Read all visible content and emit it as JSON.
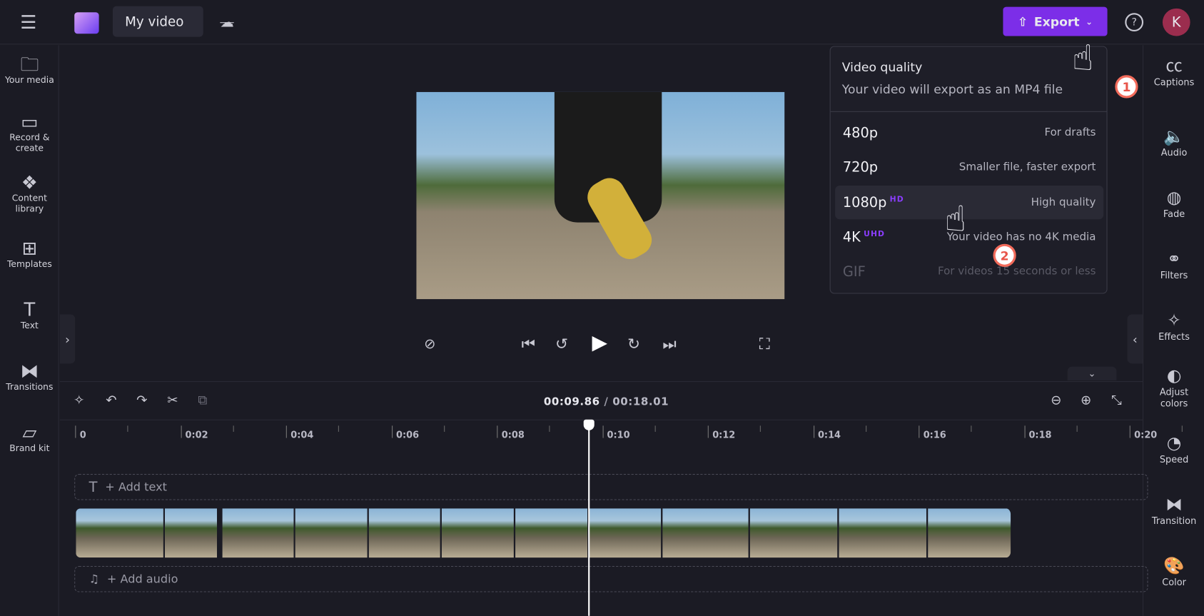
{
  "header": {
    "project_title": "My video",
    "export_label": "Export",
    "avatar_initial": "K"
  },
  "left_nav": [
    {
      "label": "Your media",
      "icon": "folder-icon"
    },
    {
      "label": "Record & create",
      "icon": "camera-icon"
    },
    {
      "label": "Content library",
      "icon": "library-icon"
    },
    {
      "label": "Templates",
      "icon": "templates-icon"
    },
    {
      "label": "Text",
      "icon": "text-icon"
    },
    {
      "label": "Transitions",
      "icon": "transitions-icon"
    },
    {
      "label": "Brand kit",
      "icon": "brand-kit-icon"
    }
  ],
  "right_nav": [
    {
      "label": "Captions"
    },
    {
      "label": "Audio"
    },
    {
      "label": "Fade"
    },
    {
      "label": "Filters"
    },
    {
      "label": "Effects"
    },
    {
      "label": "Adjust colors"
    },
    {
      "label": "Speed"
    },
    {
      "label": "Transition"
    },
    {
      "label": "Color"
    }
  ],
  "export_menu": {
    "title": "Video quality",
    "subtitle": "Your video will export as an MP4 file",
    "options": [
      {
        "label": "480p",
        "badge": "",
        "desc": "For drafts"
      },
      {
        "label": "720p",
        "badge": "",
        "desc": "Smaller file, faster export"
      },
      {
        "label": "1080p",
        "badge": "HD",
        "desc": "High quality"
      },
      {
        "label": "4K",
        "badge": "UHD",
        "desc": "Your video has no 4K media"
      },
      {
        "label": "GIF",
        "badge": "",
        "desc": "For videos 15 seconds or less"
      }
    ]
  },
  "callouts": [
    "1",
    "2"
  ],
  "timeline": {
    "current": "00:09.86",
    "separator": " / ",
    "total": "00:18.01",
    "ticks": [
      "0",
      "0:02",
      "0:04",
      "0:06",
      "0:08",
      "0:10",
      "0:12",
      "0:14",
      "0:16",
      "0:18",
      "0:20"
    ],
    "add_text": "+ Add text",
    "add_audio": "+ Add audio"
  },
  "colors": {
    "accent": "#7c2ee8",
    "badge": "#8b3dff",
    "callout": "#f26b5b"
  }
}
